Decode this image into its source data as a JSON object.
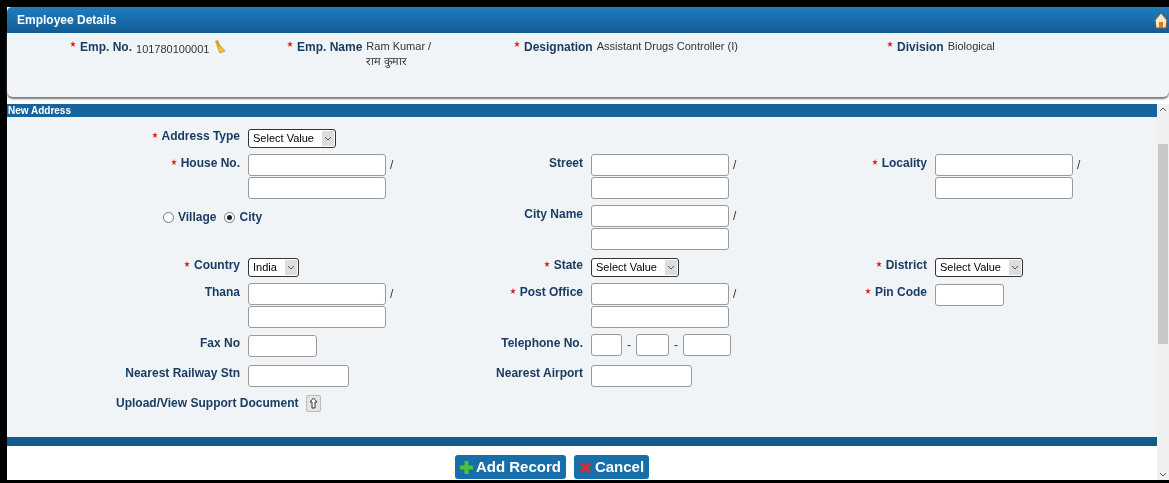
{
  "header": {
    "title": "Employee Details"
  },
  "employee": [
    {
      "label": "Emp. No.",
      "required": true,
      "lines": [
        "101780100001"
      ],
      "kind": "edit"
    },
    {
      "label": "Emp. Name",
      "required": true,
      "lines": [
        "Ram Kumar /",
        "राम कुमार"
      ],
      "kind": "text"
    },
    {
      "label": "Designation",
      "required": true,
      "lines": [
        "Assistant Drugs Controller (I)"
      ],
      "kind": "text"
    },
    {
      "label": "Division",
      "required": true,
      "lines": [
        "Biological"
      ],
      "kind": "text"
    }
  ],
  "section": {
    "title": "New Address"
  },
  "rows": [
    {
      "cells": [
        {
          "kind": "select",
          "label": "Address Type",
          "required": true,
          "value": "Select Value"
        }
      ]
    },
    {
      "cells": [
        {
          "kind": "pair",
          "label": "House No.",
          "required": true,
          "separator": "/"
        },
        {
          "kind": "pair",
          "label": "Street",
          "required": false,
          "separator": "/"
        },
        {
          "kind": "pair",
          "label": "Locality",
          "required": true,
          "separator": "/"
        }
      ]
    },
    {
      "cells": [
        {
          "kind": "radios",
          "options": [
            {
              "label": "Village",
              "selected": false
            },
            {
              "label": "City",
              "selected": true
            }
          ]
        },
        {
          "kind": "pair",
          "label": "City Name",
          "required": false,
          "separator": "/"
        }
      ]
    },
    {
      "cells": [
        {
          "kind": "select",
          "label": "Country",
          "required": true,
          "value": "India"
        },
        {
          "kind": "select",
          "label": "State",
          "required": true,
          "value": "Select Value"
        },
        {
          "kind": "select",
          "label": "District",
          "required": true,
          "value": "Select Value"
        }
      ]
    },
    {
      "cells": [
        {
          "kind": "pair",
          "label": "Thana",
          "required": false,
          "separator": "/"
        },
        {
          "kind": "pair",
          "label": "Post Office",
          "required": true,
          "separator": "/"
        },
        {
          "kind": "short",
          "label": "Pin Code",
          "required": true
        }
      ]
    },
    {
      "cells": [
        {
          "kind": "short",
          "label": "Fax No",
          "required": false
        },
        {
          "kind": "phone",
          "label": "Telephone No.",
          "required": false,
          "separators": [
            "-",
            "-"
          ]
        }
      ]
    },
    {
      "cells": [
        {
          "kind": "medium",
          "label": "Nearest Railway Stn",
          "required": false
        },
        {
          "kind": "medium",
          "label": "Nearest Airport",
          "required": false
        }
      ]
    },
    {
      "cells": [
        {
          "kind": "upload",
          "label": "Upload/View Support Document"
        }
      ]
    }
  ],
  "buttons": [
    {
      "label": "Add Record",
      "kind": "add"
    },
    {
      "label": "Cancel",
      "kind": "cancel"
    }
  ]
}
